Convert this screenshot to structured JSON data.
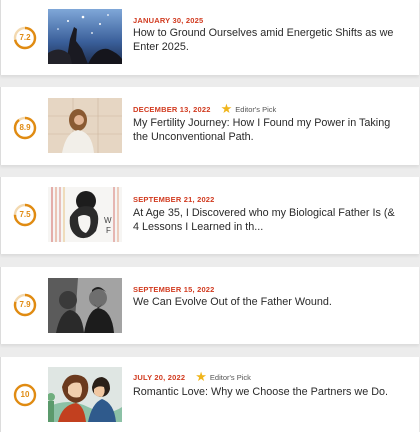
{
  "colors": {
    "date": "#d13a1f",
    "star": "#f0b51c",
    "score_ring": "#e08b12",
    "title": "#2a2a2a"
  },
  "articles": [
    {
      "score": "7.2",
      "date": "JANUARY 30, 2025",
      "editors_pick": "",
      "title": "How to Ground Ourselves amid Energetic Shifts as we Enter 2025."
    },
    {
      "score": "8.9",
      "date": "DECEMBER 13, 2022",
      "editors_pick": "Editor's Pick",
      "title": "My Fertility Journey: How I Found my Power in Taking the Unconventional Path."
    },
    {
      "score": "7.5",
      "date": "SEPTEMBER 21, 2022",
      "editors_pick": "",
      "title": "At Age 35, I Discovered who my Biological Father Is (& 4 Lessons I Learned in th..."
    },
    {
      "score": "7.9",
      "date": "SEPTEMBER 15, 2022",
      "editors_pick": "",
      "title": "We Can Evolve Out of the Father Wound."
    },
    {
      "score": "10",
      "date": "JULY 20, 2022",
      "editors_pick": "Editor's Pick",
      "title": "Romantic Love: Why we Choose the Partners we Do."
    }
  ]
}
